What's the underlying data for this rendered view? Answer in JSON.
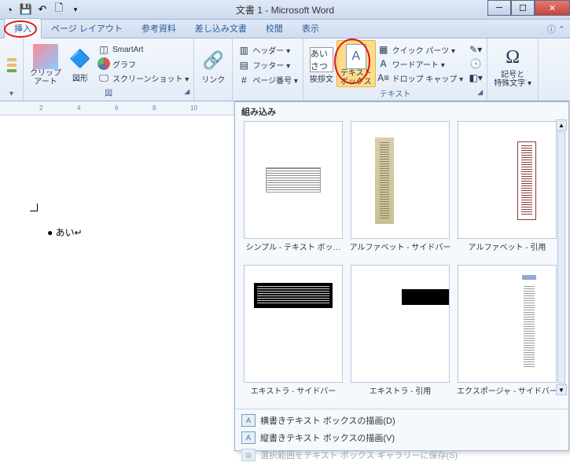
{
  "title": "文書 1 - Microsoft Word",
  "tabs": [
    "挿入",
    "ページ レイアウト",
    "参考資料",
    "差し込み文書",
    "校閲",
    "表示"
  ],
  "ribbon": {
    "clipart": "クリップ\nアート",
    "shapes": "図形",
    "smartart": "SmartArt",
    "chart": "グラフ",
    "screenshot": "スクリーンショット ▾",
    "link": "リンク",
    "header": "ヘッダー ▾",
    "footer": "フッター ▾",
    "pagenum": "ページ番号 ▾",
    "greeting": "挨拶文",
    "textbox": "テキスト\nボックス",
    "quickparts": "クイック パーツ ▾",
    "wordart": "ワードアート ▾",
    "dropcap": "ドロップ キャップ ▾",
    "symbol": "記号と\n特殊文字 ▾",
    "omega": "Ω",
    "group_illust": "図",
    "group_text": "テキスト"
  },
  "doc": {
    "text": "● あい↵"
  },
  "gallery": {
    "heading": "組み込み",
    "items": [
      "シンプル - テキスト ボッ…",
      "アルファベット - サイドバー",
      "アルファベット - 引用",
      "エキストラ - サイドバー",
      "エキストラ - 引用",
      "エクスポージャ - サイドバー"
    ],
    "footer": {
      "horiz": "横書きテキスト ボックスの描画(D)",
      "vert": "縦書きテキスト ボックスの描画(V)",
      "save": "選択範囲をテキスト ボックス ギャラリーに保存(S)"
    }
  }
}
